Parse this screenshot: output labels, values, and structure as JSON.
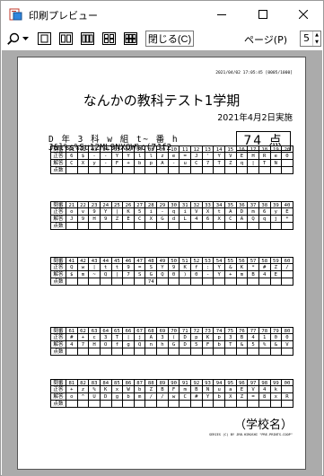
{
  "window": {
    "title": "印刷プレビュー"
  },
  "toolbar": {
    "close_label": "閉じる(C)",
    "page_label": "ページ(P)",
    "page_value": "5"
  },
  "paper": {
    "timestamp": "2021/04/02 17:05:45 [0005/1000]",
    "title": "なんかの教科テスト1学期",
    "date": "2021年4月2日実施",
    "student_line1": "D 年 3 科 w 組 t~ 番 h",
    "student_line2": "J&l%s%Su12ML9NXOW%o(7Jf2",
    "score": "74 点",
    "school": "（学校名）",
    "copyright": "SERIES (C) BY JRB.HIROSHI \"PRE-PRINTS-COOP\""
  },
  "row_labels": {
    "question": "問番",
    "correct": "正答",
    "answer": "解答",
    "points": "点数"
  },
  "blocks": [
    {
      "nums": [
        "01",
        "02",
        "03",
        "04",
        "05",
        "06",
        "07",
        "08",
        "09",
        "10",
        "11",
        "12",
        "13",
        "14",
        "15",
        "16",
        "17",
        "18",
        "19",
        "20"
      ],
      "correct": [
        "6",
        "$",
        "-",
        "-",
        "Y",
        "Y",
        "l",
        "l",
        "z",
        "e",
        "=",
        "J",
        "'",
        "Y",
        "V",
        "E",
        "H",
        "R",
        "e",
        "0"
      ],
      "answer": [
        "C",
        "X",
        "y",
        "-",
        "F",
        "+",
        "b",
        "p",
        "A",
        "-",
        "u",
        "C",
        "7",
        "T",
        "Z",
        "q",
        "|",
        "T",
        "N",
        ""
      ],
      "points": [
        "",
        "",
        "",
        "",
        "",
        "",
        "",
        "",
        "",
        "",
        "",
        "",
        "",
        "",
        "",
        "",
        "",
        "",
        "",
        ""
      ]
    },
    {
      "nums": [
        "21",
        "22",
        "23",
        "24",
        "25",
        "26",
        "27",
        "28",
        "29",
        "30",
        "31",
        "32",
        "33",
        "34",
        "35",
        "36",
        "37",
        "38",
        "39",
        "40"
      ],
      "correct": [
        "o",
        "v",
        "9",
        "Y",
        "|",
        "K",
        "5",
        "i",
        "-",
        "q",
        "i",
        "V",
        "X",
        "t",
        "A",
        "D",
        "m",
        "6",
        "y",
        "E"
      ],
      "answer": [
        "J",
        "9",
        "H",
        "9",
        "Z",
        "E",
        "C",
        "X",
        "G",
        "d",
        "L",
        "4",
        "6",
        "X",
        "C",
        "A",
        "Q",
        "q",
        "j",
        "*"
      ],
      "points": [
        "",
        "",
        "",
        "",
        "",
        "",
        "",
        "",
        "",
        "",
        "",
        "",
        "",
        "",
        "",
        "",
        "",
        "",
        "",
        ""
      ]
    },
    {
      "nums": [
        "41",
        "42",
        "43",
        "44",
        "45",
        "46",
        "47",
        "48",
        "49",
        "50",
        "51",
        "52",
        "53",
        "54",
        "55",
        "56",
        "57",
        "58",
        "59",
        "60"
      ],
      "correct": [
        "Q",
        "w",
        "|",
        "t",
        "t",
        "9",
        "=",
        "S",
        "Y",
        "9",
        "K",
        "f",
        ":",
        "Y",
        "&",
        "K",
        "*",
        "#",
        "Z",
        "/"
      ],
      "answer": [
        "$",
        "m",
        "~",
        "Q",
        "|",
        "7",
        "S",
        "G",
        "Q",
        "0",
        ")",
        "0",
        "-",
        "Y",
        "+",
        "m",
        "B",
        "4",
        "E",
        ""
      ],
      "points": [
        "",
        "",
        "",
        "",
        "",
        "",
        "",
        "74",
        "",
        "",
        "",
        "",
        "",
        "",
        "",
        "",
        "",
        "",
        "",
        ""
      ]
    },
    {
      "nums": [
        "61",
        "62",
        "63",
        "64",
        "65",
        "66",
        "67",
        "68",
        "69",
        "70",
        "71",
        "72",
        "73",
        "74",
        "75",
        "76",
        "77",
        "78",
        "79",
        "80"
      ],
      "correct": [
        "#",
        "+",
        "c",
        "3",
        "T",
        "|",
        "j",
        "A",
        "3",
        "(",
        "D",
        "p",
        "K",
        "p",
        "3",
        "B",
        "4",
        "1",
        "0",
        "0"
      ],
      "answer": [
        "4",
        "7",
        "H",
        "O",
        "f",
        "g",
        "Q",
        "n",
        "h",
        "G",
        "D",
        "5",
        "F",
        "b",
        "T",
        "&",
        "5",
        "%",
        "&",
        "V"
      ],
      "points": [
        "",
        "",
        "",
        "",
        "",
        "",
        "",
        "",
        "",
        "",
        "",
        "",
        "",
        "",
        "",
        "",
        "",
        "",
        "",
        ""
      ]
    },
    {
      "nums": [
        "81",
        "82",
        "83",
        "84",
        "85",
        "86",
        "87",
        "88",
        "89",
        "90",
        "91",
        "92",
        "93",
        "94",
        "95",
        "96",
        "97",
        "98",
        "99",
        "00"
      ],
      "correct": [
        "+",
        "z",
        "%",
        "K",
        "x",
        "W",
        "b",
        "Z",
        "B",
        "F",
        "m",
        "B",
        "N",
        "u",
        "a",
        "E",
        "V",
        "4",
        "k",
        ""
      ],
      "answer": [
        "o",
        "^",
        "U",
        "D",
        "g",
        "b",
        "m",
        "/",
        "/",
        "w",
        "C",
        "#",
        "Y",
        "b",
        "X",
        "Z",
        "=",
        "8",
        "x",
        "R"
      ],
      "points": [
        "",
        "",
        "",
        "",
        "",
        "",
        "",
        "",
        "",
        "",
        "",
        "",
        "",
        "",
        "",
        "",
        "",
        "",
        "",
        ""
      ]
    }
  ]
}
